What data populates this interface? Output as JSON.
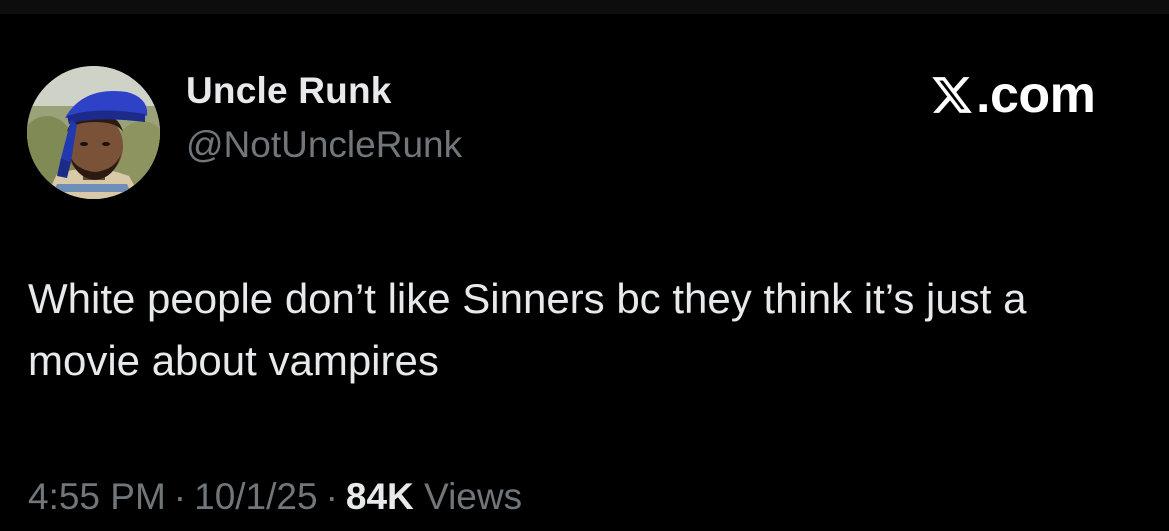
{
  "author": {
    "display_name": "Uncle Runk",
    "handle": "@NotUncleRunk",
    "avatar_icon": "profile-photo-graduation-cap"
  },
  "brand": {
    "logo_icon": "x-logo-icon",
    "text": ".com"
  },
  "tweet": {
    "text": "White people don’t like Sinners bc they think it’s just a movie about vampires"
  },
  "meta": {
    "time": "4:55 PM",
    "separator": "·",
    "date": "10/1/25",
    "views_count": "84K",
    "views_label": "Views"
  },
  "colors": {
    "background": "#000000",
    "primary_text": "#e7e9ea",
    "secondary_text": "#71767b"
  }
}
